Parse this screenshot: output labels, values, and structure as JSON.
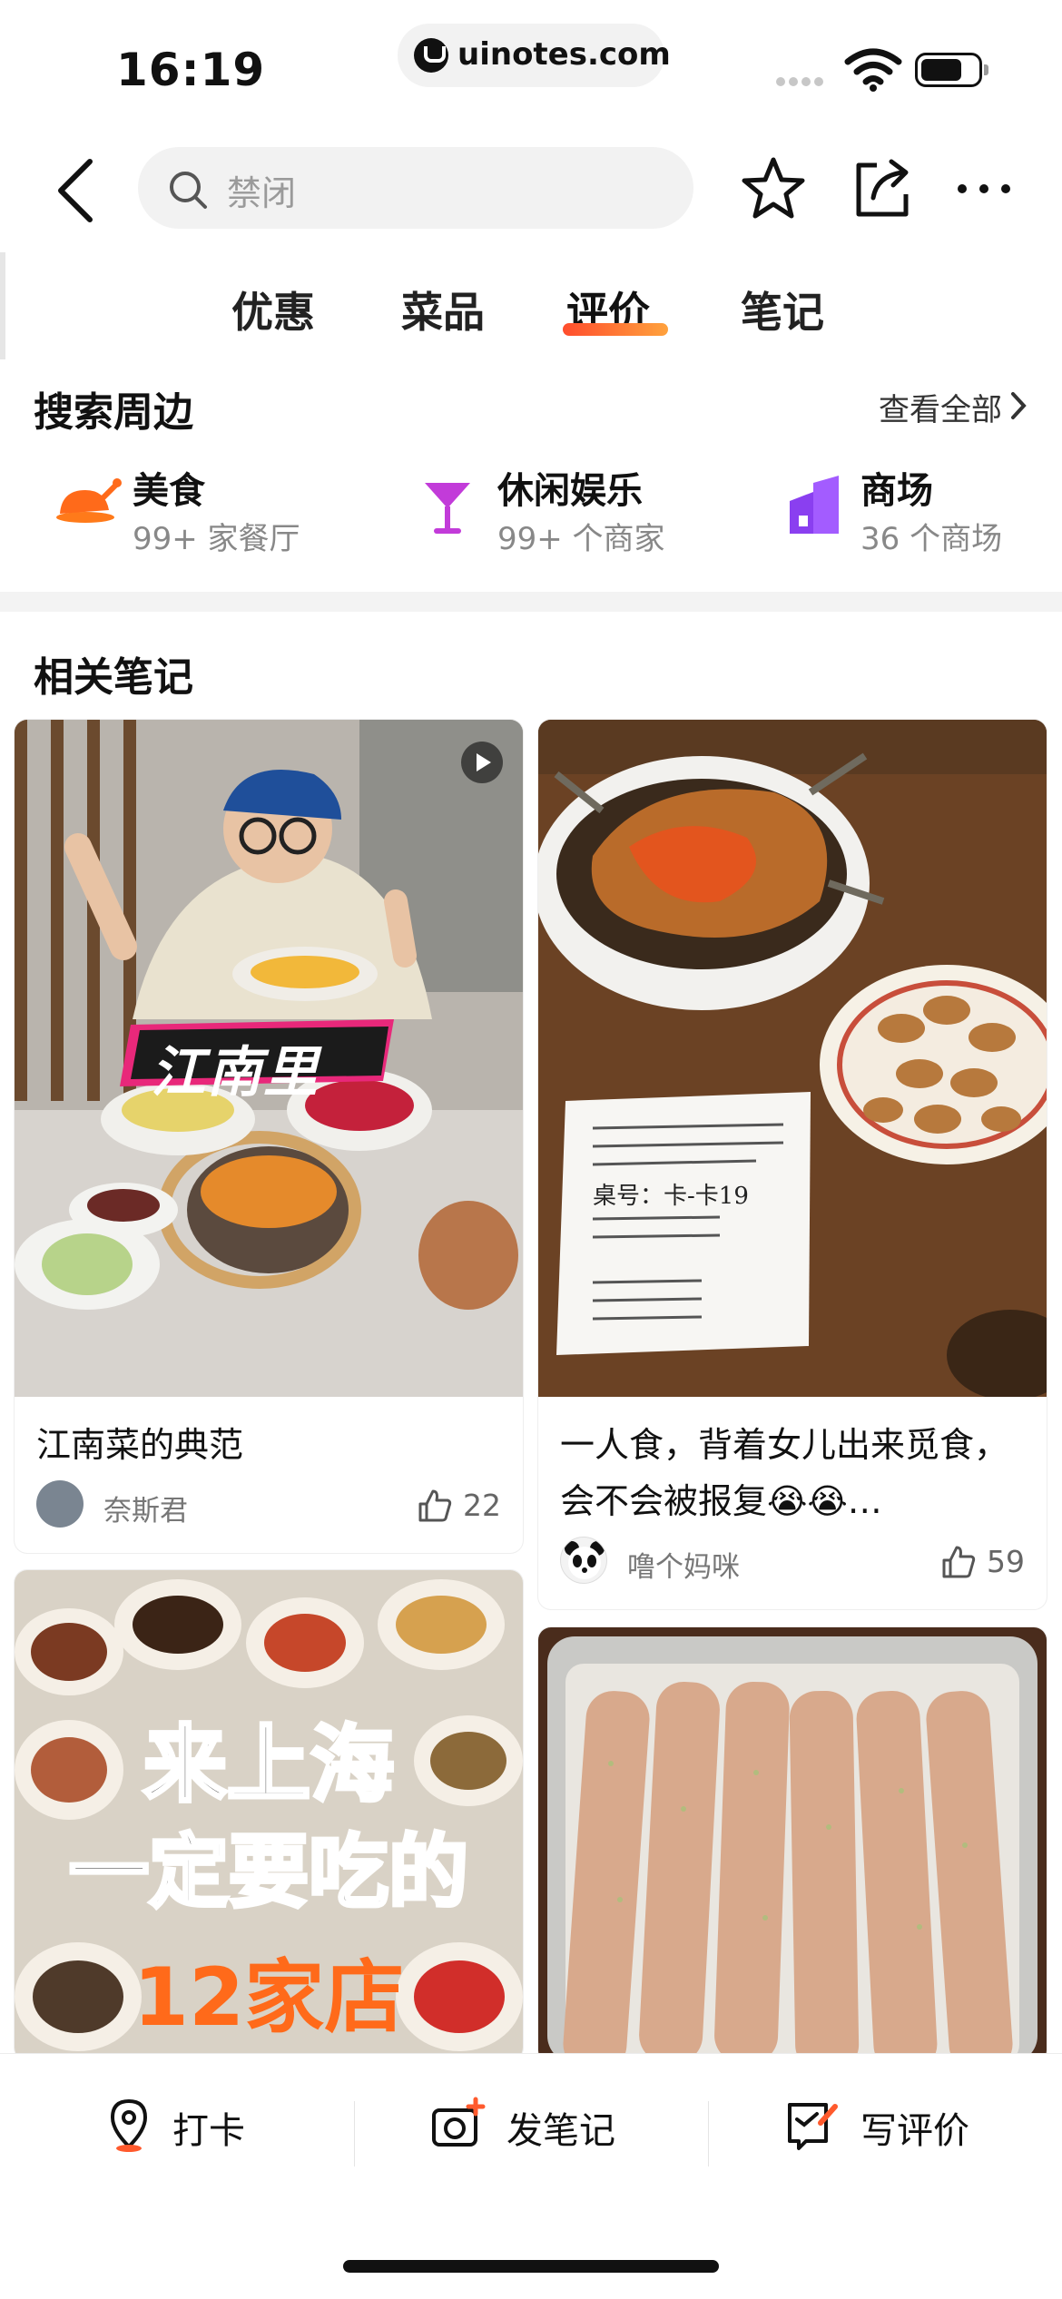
{
  "status": {
    "time": "16:19",
    "url": "uinotes.com"
  },
  "search": {
    "placeholder": "禁闭"
  },
  "tabs": [
    {
      "label": "优惠"
    },
    {
      "label": "菜品"
    },
    {
      "label": "评价"
    },
    {
      "label": "笔记"
    }
  ],
  "active_tab": "评价",
  "nearby": {
    "title": "搜索周边",
    "view_all": "查看全部",
    "categories": [
      {
        "name": "美食",
        "sub": "99+ 家餐厅",
        "icon": "roast-chicken-icon",
        "color": "#ff6a1a"
      },
      {
        "name": "休闲娱乐",
        "sub": "99+ 个商家",
        "icon": "cocktail-icon",
        "color": "#c23bd9"
      },
      {
        "name": "商场",
        "sub": "36 个商场",
        "icon": "mall-building-icon",
        "color": "#8a3ff0"
      }
    ]
  },
  "notes": {
    "title": "相关笔记",
    "cards": [
      {
        "title": "江南菜的典范",
        "author": "奈斯君",
        "likes": "22",
        "image_text": "江南里",
        "video": true
      },
      {
        "title": "一人食，背着女儿出来觅食，会不会被报复😭😭…",
        "author": "噜个妈咪",
        "likes": "59",
        "receipt_text": "桌号：卡-卡19"
      },
      {
        "image_text_line1": "来上海",
        "image_text_line2": "一定要吃的",
        "image_text_line3": "12家店"
      },
      {}
    ]
  },
  "bottom": {
    "checkin": "打卡",
    "post_note": "发笔记",
    "write_review": "写评价"
  }
}
